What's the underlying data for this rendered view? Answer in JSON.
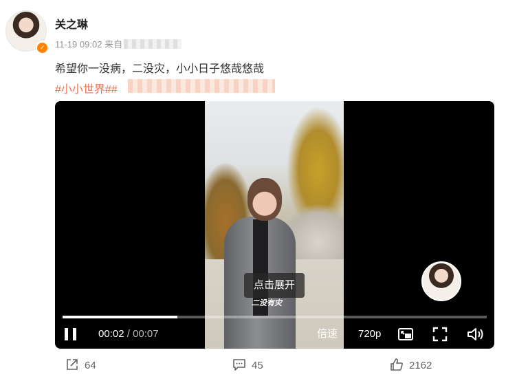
{
  "post": {
    "username": "关之琳",
    "timestamp": "11-19 09:02",
    "source_prefix": "来自",
    "text": "希望你一没病，二没灾，小小日子悠哉悠哉",
    "hashtag": "#小小世界##"
  },
  "video": {
    "expand_label": "点击展开",
    "subtitle": "二没有灾",
    "current_time": "00:02",
    "separator": " / ",
    "duration": "00:07",
    "progress_fraction": 0.27,
    "speed_label": "倍速",
    "quality_label": "720p"
  },
  "actions": {
    "share_count": "64",
    "comment_count": "45",
    "like_count": "2162"
  },
  "icons": {
    "verified": "verified-badge-icon",
    "pause": "pause-icon",
    "pip": "picture-in-picture-icon",
    "fullscreen": "fullscreen-icon",
    "volume": "volume-icon",
    "share": "share-icon",
    "comment": "comment-icon",
    "like": "like-icon"
  },
  "colors": {
    "accent": "#ff8200",
    "hashtag": "#eb7350",
    "meta": "#939393"
  }
}
